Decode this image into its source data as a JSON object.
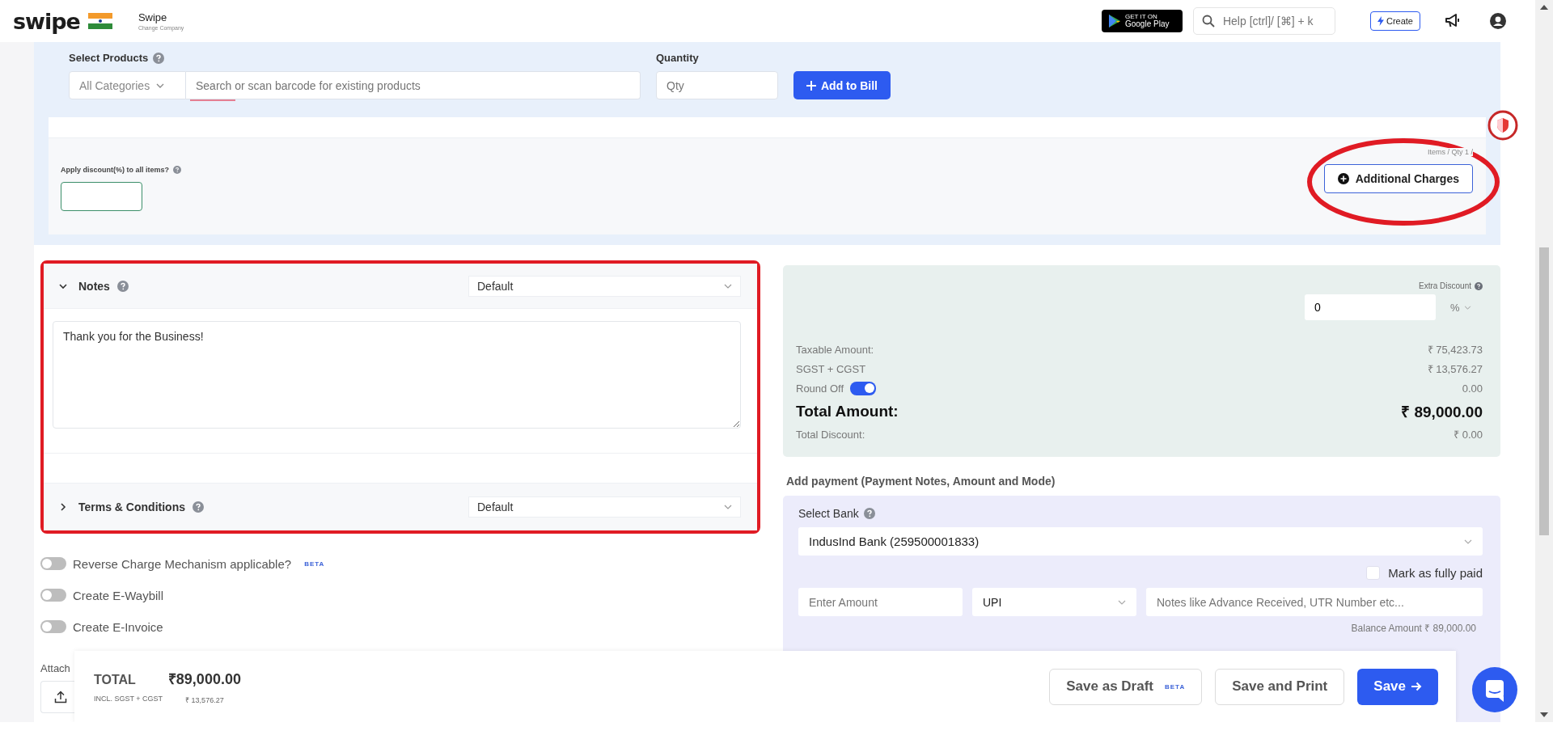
{
  "header": {
    "logo": "swipe",
    "company": "Swipe",
    "change_company": "Change Company",
    "store_badge_top": "GET IT ON",
    "store_badge": "Google Play",
    "help_placeholder": "Help [ctrl]/ [⌘] + k",
    "create_button": "Create"
  },
  "products": {
    "label": "Select Products",
    "category": "All Categories",
    "search_placeholder": "Search or scan barcode for existing products",
    "quantity_label": "Quantity",
    "qty_placeholder": "Qty",
    "add_button": "Add to Bill"
  },
  "items_summary": "Items / Qty 1 /",
  "discount": {
    "label": "Apply discount(%) to all items?"
  },
  "additional_charges": {
    "label": "Additional Charges",
    "circled": true
  },
  "notes": {
    "title": "Notes",
    "expanded": true,
    "highlighted": true,
    "template": "Default",
    "text": "Thank you for the Business!"
  },
  "terms": {
    "title": "Terms & Conditions",
    "expanded": false,
    "template": "Default"
  },
  "toggles": [
    {
      "label": "Reverse Charge Mechanism applicable?",
      "on": false,
      "badge": "BETA"
    },
    {
      "label": "Create E-Waybill",
      "on": false
    },
    {
      "label": "Create E-Invoice",
      "on": false
    }
  ],
  "attach": {
    "label": "Attach"
  },
  "summary": {
    "extra_discount_label": "Extra Discount",
    "extra_discount": "0",
    "discount_unit": "%",
    "rows": [
      {
        "kind": "plain",
        "label": "Taxable Amount:",
        "value": "₹ 75,423.73"
      },
      {
        "kind": "plain",
        "label": "SGST + CGST",
        "value": "₹ 13,576.27"
      },
      {
        "kind": "toggle",
        "label": "Round Off",
        "on": true,
        "value": "0.00"
      },
      {
        "kind": "total",
        "label": "Total Amount:",
        "value": "₹ 89,000.00"
      },
      {
        "kind": "plain",
        "label": "Total Discount:",
        "value": "₹ 0.00"
      }
    ]
  },
  "payment": {
    "heading": "Add payment (Payment Notes, Amount and Mode)",
    "bank_label": "Select Bank",
    "bank": "IndusInd Bank (259500001833)",
    "fully_paid_label": "Mark as fully paid",
    "fully_paid": false,
    "amount_placeholder": "Enter Amount",
    "mode": "UPI",
    "notes_placeholder": "Notes like Advance Received, UTR Number etc...",
    "balance": "Balance Amount  ₹ 89,000.00"
  },
  "footer": {
    "total_label": "TOTAL",
    "total": "₹89,000.00",
    "tax_label": "INCL. SGST + CGST",
    "tax": "₹ 13,576.27",
    "buttons": [
      {
        "kind": "draft",
        "label": "Save as Draft",
        "badge": "BETA"
      },
      {
        "kind": "secondary",
        "label": "Save and Print"
      },
      {
        "kind": "primary",
        "label": "Save"
      }
    ]
  }
}
